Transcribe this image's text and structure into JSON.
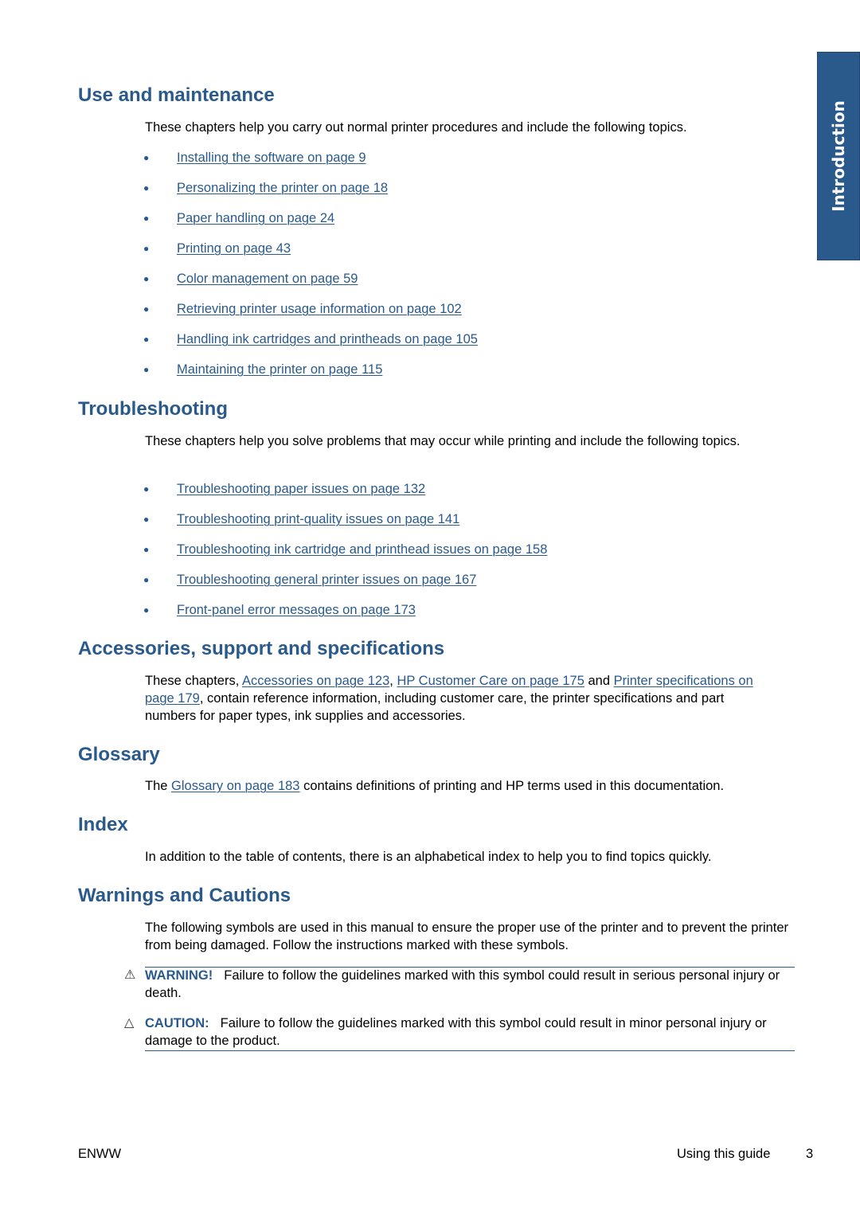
{
  "side_tab": {
    "label": "Introduction"
  },
  "sections": {
    "use_and_maintenance": {
      "heading": "Use and maintenance",
      "intro": "These chapters help you carry out normal printer procedures and include the following topics.",
      "links": [
        "Installing the software on page 9",
        "Personalizing the printer on page 18",
        "Paper handling on page 24",
        "Printing on page 43",
        "Color management on page 59",
        "Retrieving printer usage information on page 102",
        "Handling ink cartridges and printheads on page 105",
        "Maintaining the printer on page 115"
      ]
    },
    "troubleshooting": {
      "heading": "Troubleshooting",
      "intro": "These chapters help you solve problems that may occur while printing and include the following topics.",
      "links": [
        "Troubleshooting paper issues on page 132",
        "Troubleshooting print-quality issues on page 141",
        "Troubleshooting ink cartridge and printhead issues on page 158",
        "Troubleshooting general printer issues on page 167",
        "Front-panel error messages on page 173"
      ]
    },
    "accessories": {
      "heading": "Accessories, support and specifications",
      "text_1": "These chapters, ",
      "link_1": "Accessories on page 123",
      "text_2": ", ",
      "link_2": "HP Customer Care on page 175",
      "text_3": " and ",
      "link_3": "Printer specifications on page 179",
      "text_4": ", contain reference information, including customer care, the printer specifications and part numbers for paper types, ink supplies and accessories."
    },
    "glossary": {
      "heading": "Glossary",
      "text_1": "The ",
      "link_1": "Glossary on page 183",
      "text_2": " contains definitions of printing and HP terms used in this documentation."
    },
    "index": {
      "heading": "Index",
      "text": "In addition to the table of contents, there is an alphabetical index to help you to find topics quickly."
    },
    "warnings": {
      "heading": "Warnings and Cautions",
      "intro": "The following symbols are used in this manual to ensure the proper use of the printer and to prevent the printer from being damaged. Follow the instructions marked with these symbols.",
      "warning": {
        "icon": "warning-triangle-icon",
        "symbol": "⚠",
        "label": "WARNING!",
        "text": "Failure to follow the guidelines marked with this symbol could result in serious personal injury or death."
      },
      "caution": {
        "icon": "caution-triangle-icon",
        "symbol": "△",
        "label": "CAUTION:",
        "text": "Failure to follow the guidelines marked with this symbol could result in minor personal injury or damage to the product."
      }
    }
  },
  "footer": {
    "left": "ENWW",
    "section": "Using this guide",
    "page_number": "3"
  },
  "colors": {
    "accent": "#2a5a8c",
    "text": "#000000"
  },
  "bullet_symbol": "●"
}
